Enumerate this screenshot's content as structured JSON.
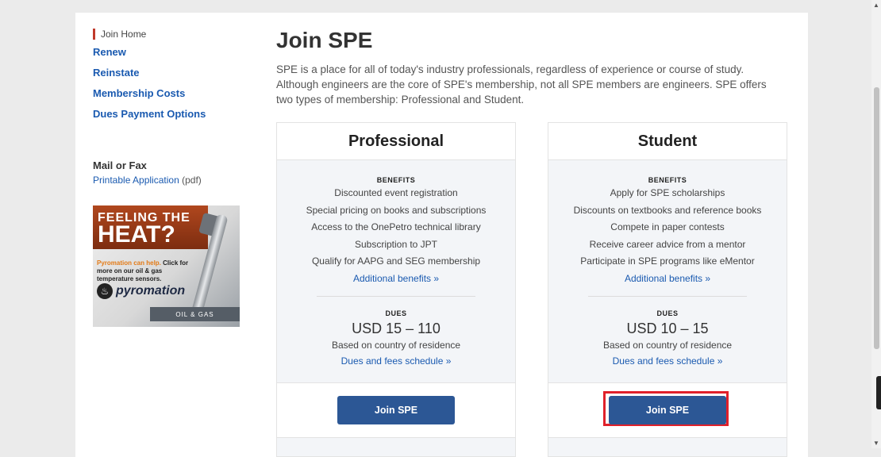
{
  "sidebar": {
    "current": "Join Home",
    "links": [
      "Renew",
      "Reinstate",
      "Membership Costs",
      "Dues Payment Options"
    ],
    "mail_title": "Mail or Fax",
    "application_link": "Printable Application",
    "application_suffix": "(pdf)"
  },
  "ad": {
    "line1": "FEELING THE",
    "line2": "HEAT?",
    "highlight": "Pyromation can help.",
    "subtext": "Click for more on our oil & gas temperature sensors.",
    "brand": "pyromation",
    "tag": "OIL & GAS"
  },
  "main": {
    "title": "Join SPE",
    "intro": "SPE is a place for all of today's industry professionals, regardless of experience or course of study. Although engineers are the core of SPE's membership, not all SPE members are engineers. SPE offers two types of membership: Professional and Student."
  },
  "cards": [
    {
      "heading": "Professional",
      "benefits_label": "BENEFITS",
      "benefits": [
        "Discounted event registration",
        "Special pricing on books and subscriptions",
        "Access to the OnePetro technical library",
        "Subscription to JPT",
        "Qualify for AAPG and SEG membership"
      ],
      "more": "Additional benefits »",
      "dues_label": "DUES",
      "dues_amount": "USD 15 – 110",
      "dues_note": "Based on country of residence",
      "dues_link": "Dues and fees schedule »",
      "button": "Join SPE"
    },
    {
      "heading": "Student",
      "benefits_label": "BENEFITS",
      "benefits": [
        "Apply for SPE scholarships",
        "Discounts on textbooks and reference books",
        "Compete in paper contests",
        "Receive career advice from a mentor",
        "Participate in SPE programs like eMentor"
      ],
      "more": "Additional benefits »",
      "dues_label": "DUES",
      "dues_amount": "USD 10 – 15",
      "dues_note": "Based on country of residence",
      "dues_link": "Dues and fees schedule »",
      "button": "Join SPE"
    }
  ],
  "colors": {
    "link": "#1a5ab0",
    "button": "#2c5795",
    "highlight": "#e0202a",
    "active_marker": "#c0392b"
  }
}
